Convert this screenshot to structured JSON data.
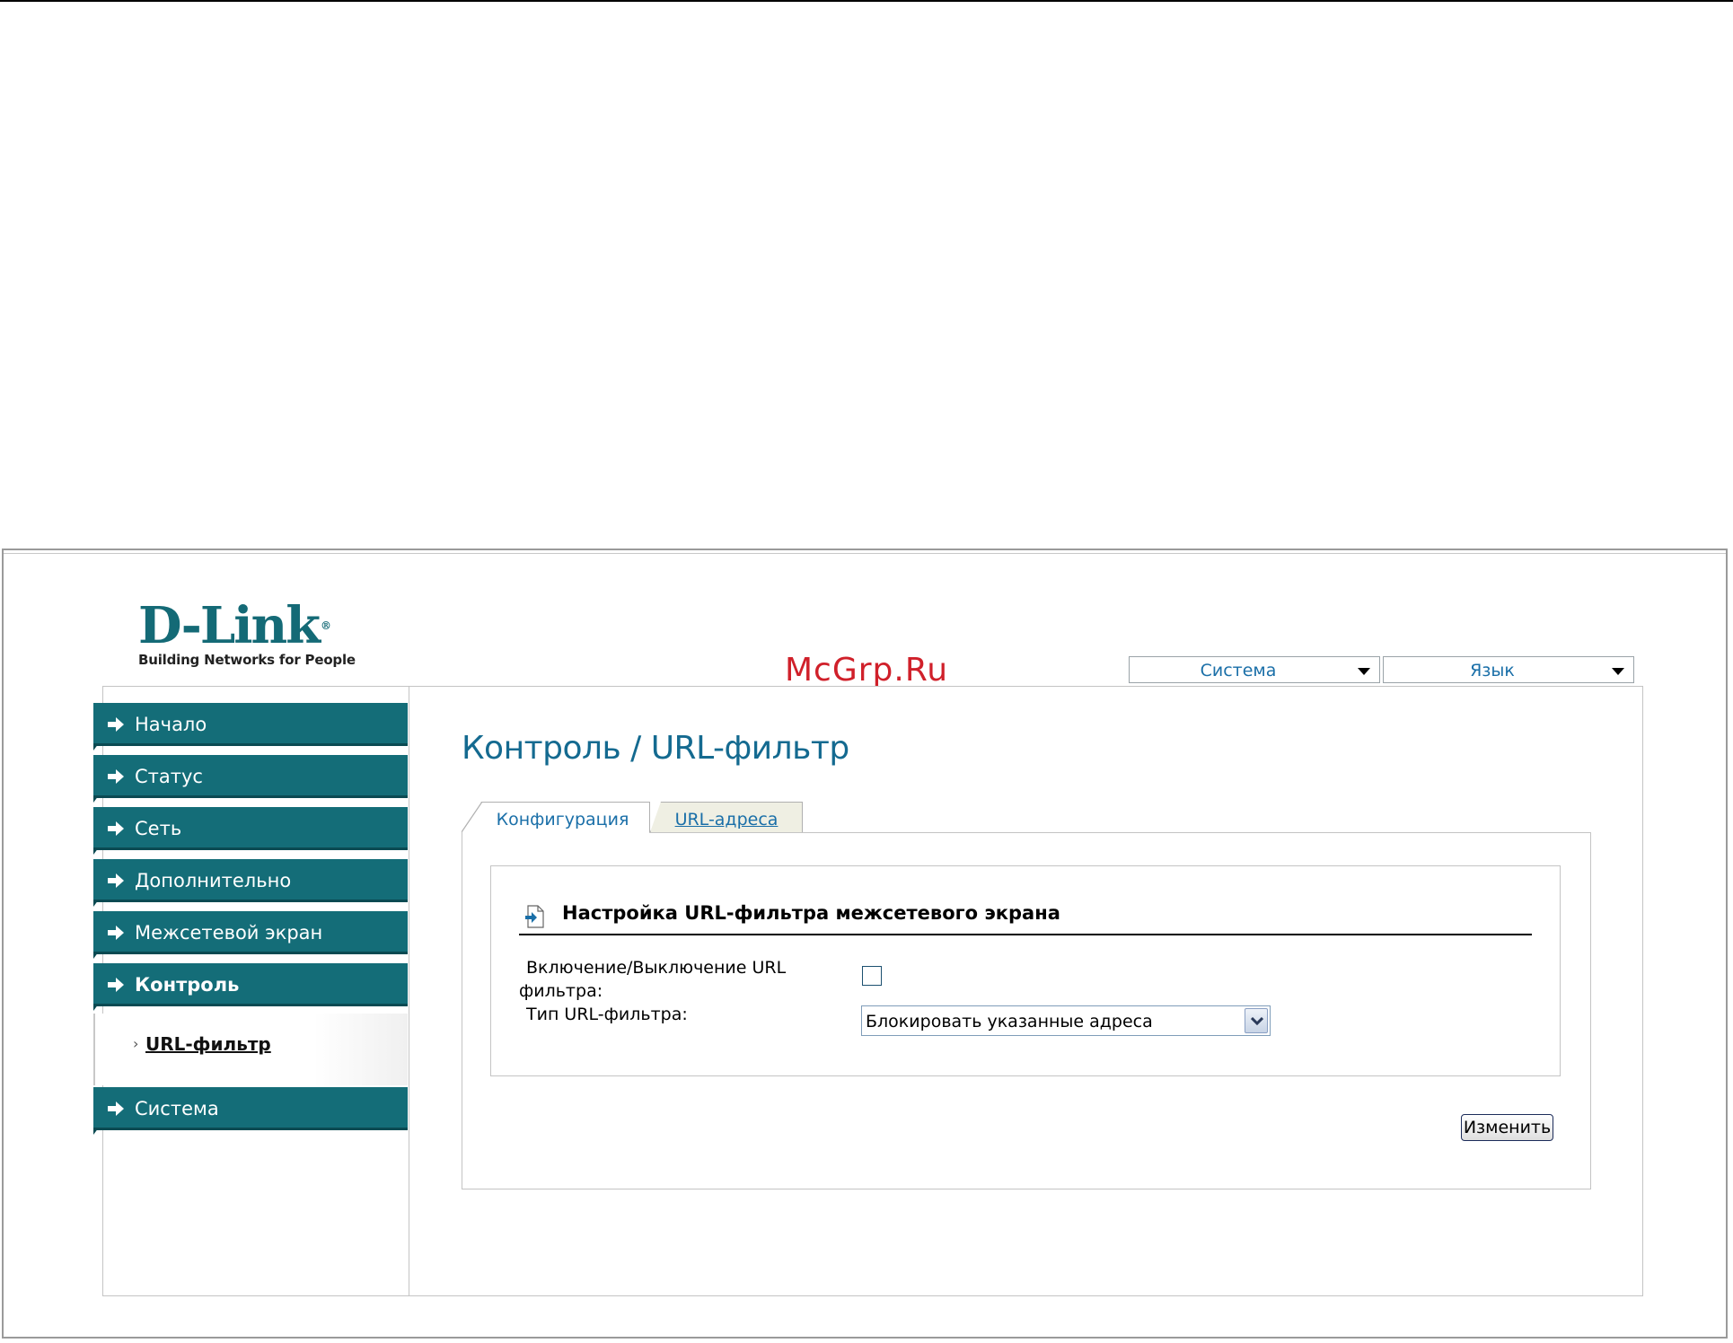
{
  "watermark": "McGrp.Ru",
  "logo": {
    "brand": "D-Link",
    "registered": "®",
    "tagline": "Building Networks for People"
  },
  "top_menu": {
    "system_label": "Система",
    "language_label": "Язык"
  },
  "sidebar": {
    "items": [
      {
        "label": "Начало"
      },
      {
        "label": "Статус"
      },
      {
        "label": "Сеть"
      },
      {
        "label": "Дополнительно"
      },
      {
        "label": "Межсетевой экран"
      },
      {
        "label": "Контроль"
      },
      {
        "label": "Система"
      }
    ],
    "sub_items": [
      {
        "bullet": "›",
        "label": "URL-фильтр"
      }
    ]
  },
  "page": {
    "title": "Контроль / URL-фильтр",
    "tabs": [
      {
        "label": "Конфигурация"
      },
      {
        "label": "URL-адреса"
      }
    ],
    "section_title": "Настройка URL-фильтра межсетевого экрана",
    "fields": {
      "enable_label_line1": "Включение/Выключение URL",
      "enable_label_line2": "фильтра:",
      "type_label": "Тип URL-фильтра:",
      "type_value": "Блокировать указанные адреса"
    },
    "apply_button": "Изменить"
  },
  "colors": {
    "nav_bg": "#146d78",
    "title": "#146a90",
    "link": "#1a6fa8",
    "watermark": "#d0202a"
  }
}
